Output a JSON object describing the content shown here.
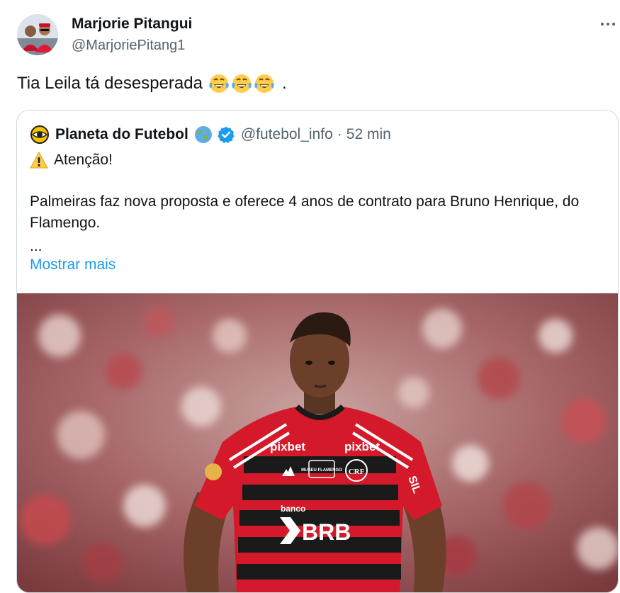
{
  "tweet": {
    "author_name": "Marjorie Pitangui",
    "author_handle": "@MarjoriePitang1",
    "text": "Tia Leila tá desesperada",
    "text_suffix": ".",
    "emojis": [
      "face-with-tears-of-joy",
      "face-with-tears-of-joy",
      "face-with-tears-of-joy"
    ]
  },
  "quoted": {
    "author_name": "Planeta do Futebol",
    "author_handle": "@futebol_info",
    "separator": "·",
    "timestamp": "52 min",
    "heading": "Atenção!",
    "body": "Palmeiras faz nova proposta e oferece 4 anos de contrato para Bruno Henrique, do Flamengo.",
    "ellipsis": "...",
    "show_more": "Mostrar mais",
    "jersey": {
      "sponsor_left": "pixbet",
      "sponsor_right": "pixbet",
      "badge": "MUSEU FLAMENGO",
      "crest": "CRF",
      "sleeve": "SIL",
      "banco": "banco",
      "brb": "BRB"
    }
  },
  "colors": {
    "text": "#0f1419",
    "secondary": "#536471",
    "link": "#1d9bf0",
    "verified": "#1d9bf0",
    "border": "#cfd9de"
  }
}
